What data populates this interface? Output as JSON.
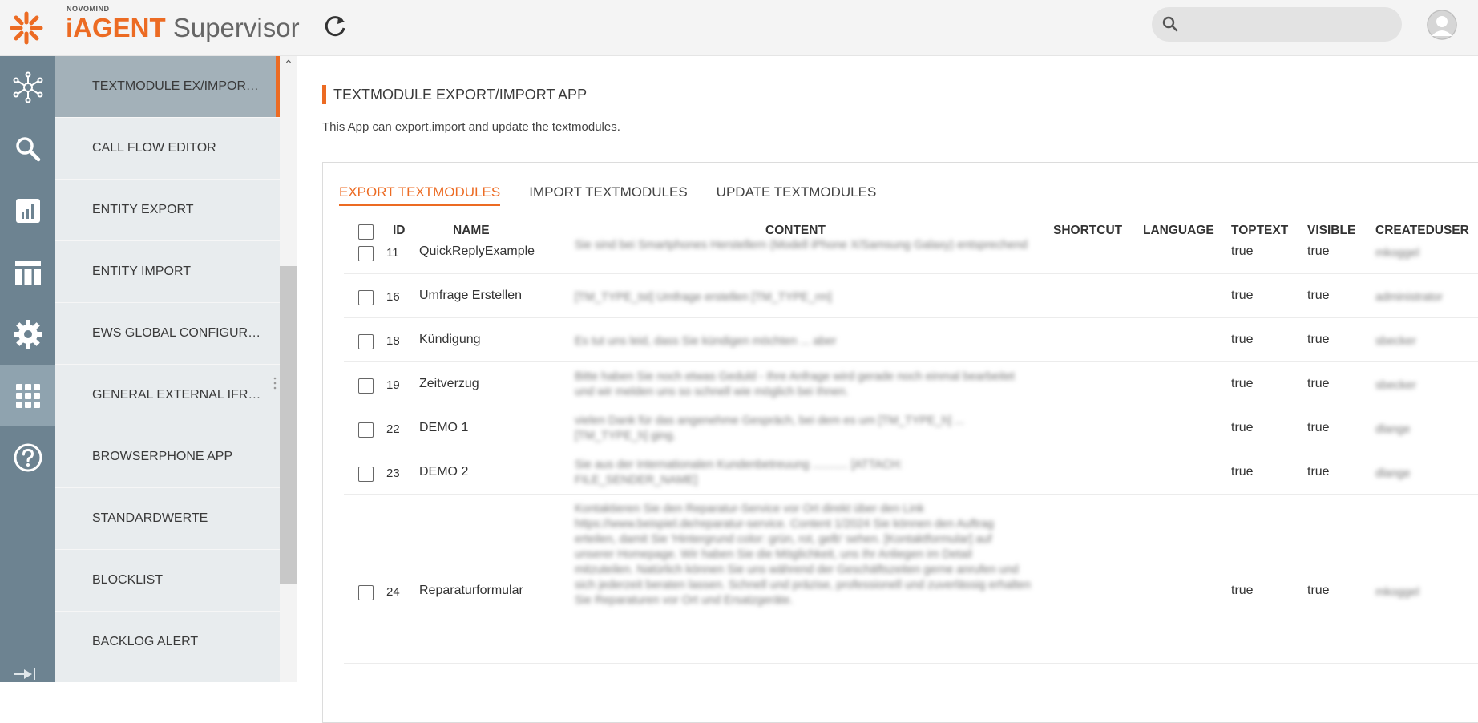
{
  "header": {
    "brand_small": "NOVOMIND",
    "brand_part1": "iAGENT",
    "brand_part2": "Supervisor",
    "search_placeholder": ""
  },
  "rail": {
    "items": [
      "network-icon",
      "search-icon",
      "chart-icon",
      "table-icon",
      "gear-icon",
      "apps-grid-icon",
      "help-icon"
    ],
    "active_index": 5
  },
  "subnav": {
    "items": [
      {
        "label": "TEXTMODULE EX/IMPORT APP",
        "active": true
      },
      {
        "label": "CALL FLOW EDITOR",
        "active": false
      },
      {
        "label": "ENTITY EXPORT",
        "active": false
      },
      {
        "label": "ENTITY IMPORT",
        "active": false
      },
      {
        "label": "EWS GLOBAL CONFIGURATION",
        "active": false
      },
      {
        "label": "GENERAL EXTERNAL IFRAME APP",
        "active": false
      },
      {
        "label": "BROWSERPHONE APP",
        "active": false
      },
      {
        "label": "STANDARDWERTE",
        "active": false
      },
      {
        "label": "BLOCKLIST",
        "active": false
      },
      {
        "label": "BACKLOG ALERT",
        "active": false
      }
    ]
  },
  "page": {
    "title": "TEXTMODULE EXPORT/IMPORT APP",
    "description": "This App can export,import and update the textmodules."
  },
  "tabs": [
    {
      "label": "EXPORT TEXTMODULES",
      "active": true
    },
    {
      "label": "IMPORT TEXTMODULES",
      "active": false
    },
    {
      "label": "UPDATE TEXTMODULES",
      "active": false
    }
  ],
  "table": {
    "columns": {
      "id": "ID",
      "name": "NAME",
      "content": "CONTENT",
      "shortcut": "SHORTCUT",
      "language": "LANGUAGE",
      "toptext": "TOPTEXT",
      "visible": "VISIBLE",
      "createduser": "CREATEDUSER"
    },
    "rows": [
      {
        "id": "11",
        "name": "QuickReplyExample",
        "content": "Sie sind bei Smartphones Herstellern (Modell iPhone X/Samsung Galaxy) entsprechend",
        "shortcut": "",
        "language": "",
        "toptext": "true",
        "visible": "true",
        "createduser": "mkoggel"
      },
      {
        "id": "16",
        "name": "Umfrage Erstellen",
        "content": "[TM_TYPE_tst] Umfrage erstellen [TM_TYPE_rm]",
        "shortcut": "",
        "language": "",
        "toptext": "true",
        "visible": "true",
        "createduser": "administrator"
      },
      {
        "id": "18",
        "name": "Kündigung",
        "content": "Es tut uns leid, dass Sie kündigen möchten ... aber",
        "shortcut": "",
        "language": "",
        "toptext": "true",
        "visible": "true",
        "createduser": "sbecker"
      },
      {
        "id": "19",
        "name": "Zeitverzug",
        "content": "Bitte haben Sie noch etwas Geduld - Ihre Anfrage wird gerade noch einmal bearbeitet und wir melden uns so schnell wie möglich bei Ihnen.",
        "shortcut": "",
        "language": "",
        "toptext": "true",
        "visible": "true",
        "createduser": "sbecker"
      },
      {
        "id": "22",
        "name": "DEMO 1",
        "content": "vielen Dank für das angenehme Gespräch, bei dem es um [TM_TYPE_h] ... [TM_TYPE_h] ging.",
        "shortcut": "",
        "language": "",
        "toptext": "true",
        "visible": "true",
        "createduser": "dlange"
      },
      {
        "id": "23",
        "name": "DEMO 2",
        "content": "Sie aus der Internationalen Kundenbetreuung ........... [ATTACH: FILE_SENDER_NAME]",
        "shortcut": "",
        "language": "",
        "toptext": "true",
        "visible": "true",
        "createduser": "dlange"
      },
      {
        "id": "24",
        "name": "Reparaturformular",
        "content": "Kontaktieren Sie den Reparatur-Service vor Ort direkt über den Link https://www.beispiel.de/reparatur-service. Content 1/2024 Sie können den Auftrag erteilen, damit Sie 'Hintergrund color: grün, rot, gelb' sehen. [Kontaktformular] auf unserer Homepage. Wir haben Sie die Möglichkeit, uns Ihr Anliegen im Detail mitzuteilen. Natürlich können Sie uns während der Geschäftszeiten gerne anrufen und sich jederzeit beraten lassen. Schnell und präzise, professionell und zuverlässig erhalten Sie Reparaturen vor Ort und Ersatzgeräte.",
        "shortcut": "",
        "language": "",
        "toptext": "true",
        "visible": "true",
        "createduser": "mkoggel"
      }
    ]
  },
  "colors": {
    "accent": "#ec6b23",
    "rail": "#6d8391",
    "subnav": "#e8ecee",
    "subnav_active": "#a3b1b9"
  }
}
